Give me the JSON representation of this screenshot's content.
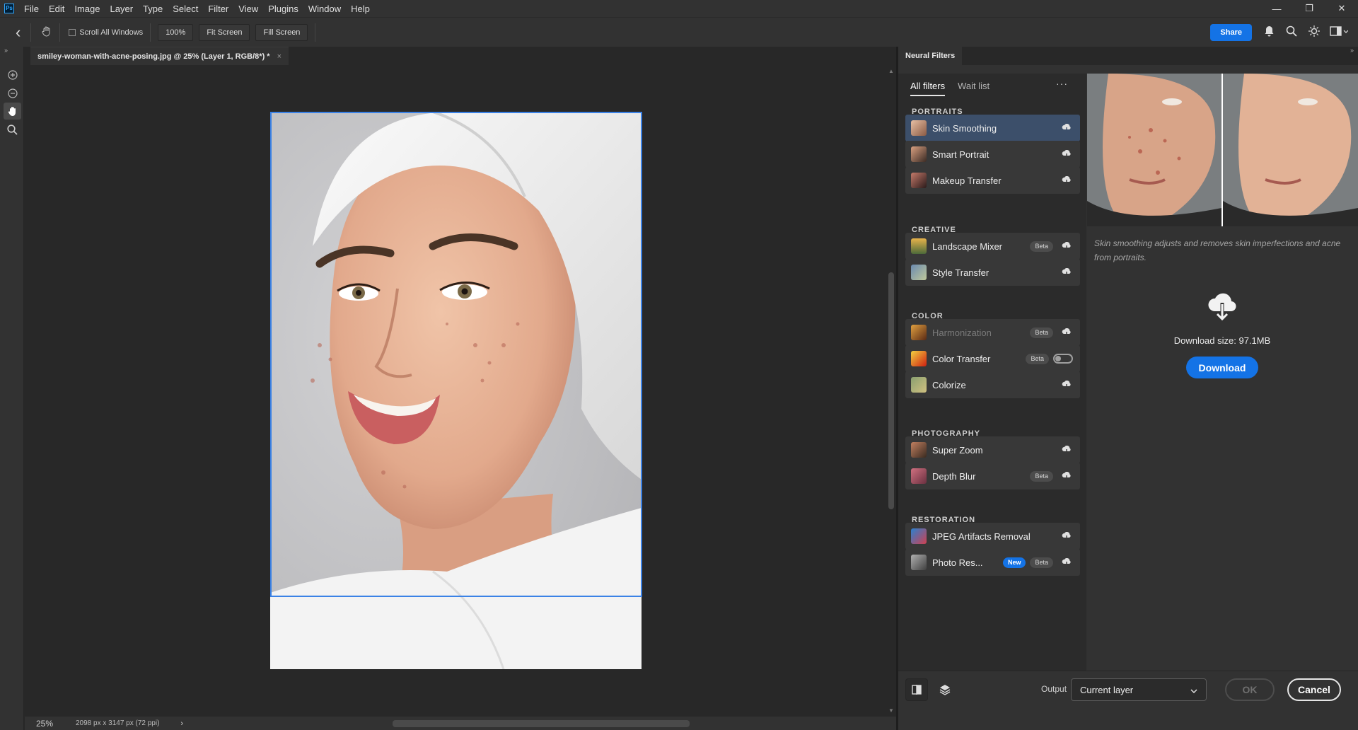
{
  "menu": {
    "items": [
      "File",
      "Edit",
      "Image",
      "Layer",
      "Type",
      "Select",
      "Filter",
      "View",
      "Plugins",
      "Window",
      "Help"
    ],
    "logo": "Ps"
  },
  "window_controls": {
    "minimize": "—",
    "restore": "❐",
    "close": "✕"
  },
  "options_bar": {
    "back_icon": "‹",
    "scroll_all_windows_label": "Scroll All Windows",
    "zoom_label": "100%",
    "fit_screen_label": "Fit Screen",
    "fill_screen_label": "Fill Screen",
    "share_label": "Share"
  },
  "document": {
    "tab_title": "smiley-woman-with-acne-posing.jpg @ 25% (Layer 1, RGB/8*) *",
    "tab_close": "×"
  },
  "status": {
    "zoom": "25%",
    "doc_info": "2098 px x 3147 px (72 ppi)",
    "arrow": "›"
  },
  "neural_filters": {
    "panel_title": "Neural Filters",
    "tabs": [
      "All filters",
      "Wait list"
    ],
    "more": "···",
    "categories": {
      "portraits": "PORTRAITS",
      "creative": "CREATIVE",
      "color": "COLOR",
      "photography": "PHOTOGRAPHY",
      "restoration": "RESTORATION"
    },
    "filters": {
      "skin_smoothing": "Skin Smoothing",
      "smart_portrait": "Smart Portrait",
      "makeup_transfer": "Makeup Transfer",
      "landscape_mixer": "Landscape Mixer",
      "style_transfer": "Style Transfer",
      "harmonization": "Harmonization",
      "color_transfer": "Color Transfer",
      "colorize": "Colorize",
      "super_zoom": "Super Zoom",
      "depth_blur": "Depth Blur",
      "jpeg_artifacts": "JPEG Artifacts Removal",
      "photo_restoration": "Photo Res..."
    },
    "badges": {
      "beta": "Beta",
      "new": "New"
    },
    "detail": {
      "description": "Skin smoothing adjusts and removes skin imperfections and acne from portraits.",
      "download_size": "Download size: 97.1MB",
      "download_label": "Download"
    },
    "footer": {
      "output_label": "Output",
      "output_value": "Current layer",
      "ok_label": "OK",
      "cancel_label": "Cancel"
    }
  },
  "colors": {
    "accent": "#1473e6",
    "selection": "#3b82e6",
    "panel_bg": "#323232",
    "canvas_bg": "#282828"
  }
}
